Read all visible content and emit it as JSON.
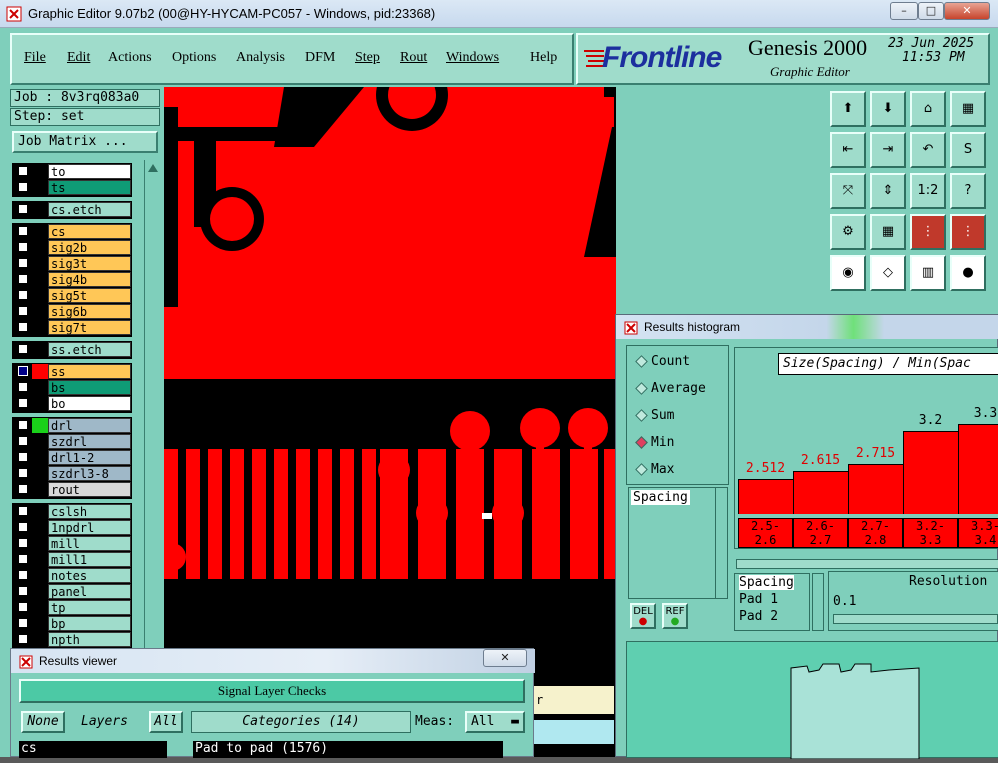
{
  "window": {
    "title": "Graphic Editor 9.07b2 (00@HY-HYCAM-PC057 - Windows, pid:23368)",
    "minimize": "–",
    "maximize": "□",
    "close": "✕"
  },
  "menu": {
    "items": [
      "File",
      "Edit",
      "Actions",
      "Options",
      "Analysis",
      "DFM",
      "Step",
      "Rout",
      "Windows",
      "Help"
    ]
  },
  "branding": {
    "logo_text": "Frontline",
    "product": "Genesis 2000",
    "subtitle": "Graphic Editor",
    "date": "23 Jun 2025",
    "time": "11:53 PM"
  },
  "job": {
    "job_label": "Job : 8v3rq083a0",
    "step_label": "Step: set",
    "job_matrix_button": "Job Matrix ..."
  },
  "layers": [
    {
      "name": "to",
      "color": "#ffffff"
    },
    {
      "name": "ts",
      "color": "#0f9b76"
    },
    {
      "name": "cs.etch",
      "color": "#9fdccb"
    },
    {
      "name": "cs",
      "color": "#ffc757"
    },
    {
      "name": "sig2b",
      "color": "#ffc757"
    },
    {
      "name": "sig3t",
      "color": "#ffc757"
    },
    {
      "name": "sig4b",
      "color": "#ffc757"
    },
    {
      "name": "sig5t",
      "color": "#ffc757"
    },
    {
      "name": "sig6b",
      "color": "#ffc757"
    },
    {
      "name": "sig7t",
      "color": "#ffc757"
    },
    {
      "name": "ss.etch",
      "color": "#9fdccb"
    },
    {
      "name": "ss",
      "color": "#ffc757"
    },
    {
      "name": "bs",
      "color": "#0f9b76"
    },
    {
      "name": "bo",
      "color": "#ffffff"
    },
    {
      "name": "drl",
      "color": "#9fb8c8"
    },
    {
      "name": "szdrl",
      "color": "#9fb8c8"
    },
    {
      "name": "drl1-2",
      "color": "#9fb8c8"
    },
    {
      "name": "szdrl3-8",
      "color": "#9fb8c8"
    },
    {
      "name": "rout",
      "color": "#d9d9d9"
    },
    {
      "name": "cslsh",
      "color": "#9fdccb"
    },
    {
      "name": "1npdrl",
      "color": "#9fdccb"
    },
    {
      "name": "mill",
      "color": "#9fdccb"
    },
    {
      "name": "mill1",
      "color": "#9fdccb"
    },
    {
      "name": "notes",
      "color": "#9fdccb"
    },
    {
      "name": "panel",
      "color": "#9fdccb"
    },
    {
      "name": "tp",
      "color": "#9fdccb"
    },
    {
      "name": "bp",
      "color": "#9fdccb"
    },
    {
      "name": "npth",
      "color": "#9fdccb"
    }
  ],
  "histogram": {
    "title": "Results histogram",
    "modes": [
      "Count",
      "Average",
      "Sum",
      "Min",
      "Max"
    ],
    "selected_mode": "Min",
    "header": "Size(Spacing) / Min(Spac",
    "measure_list": [
      "Spacing"
    ],
    "del_button": "DEL",
    "ref_button": "REF",
    "attr_list": [
      "Spacing",
      "Pad 1",
      "Pad 2"
    ],
    "resolution_label": "Resolution",
    "resolution_value": "0.1",
    "chart_data": {
      "type": "bar",
      "categories": [
        "2.5-2.6",
        "2.6-2.7",
        "2.7-2.8",
        "3.2-3.3",
        "3.3-3.4"
      ],
      "values": [
        2.512,
        2.615,
        2.715,
        3.2,
        3.3
      ],
      "value_labels": [
        "2.512",
        "2.615",
        "2.715",
        "3.2",
        "3.3"
      ],
      "bin_labels": [
        [
          "2.5-",
          "2.6"
        ],
        [
          "2.6-",
          "2.7"
        ],
        [
          "2.7-",
          "2.8"
        ],
        [
          "3.2-",
          "3.3"
        ],
        [
          "3.3-",
          "3.4"
        ]
      ],
      "color": "#ff0000"
    }
  },
  "results_viewer": {
    "title": "Results viewer",
    "close": "✕",
    "header": "Signal Layer Checks",
    "none_button": "None",
    "layers_label": "Layers",
    "all_button": "All",
    "categories_label": "Categories (14)",
    "meas_label": "Meas:",
    "meas_value": "All",
    "layer_value": "cs",
    "category_value": "Pad to pad (1576)",
    "partial_label": "r"
  }
}
